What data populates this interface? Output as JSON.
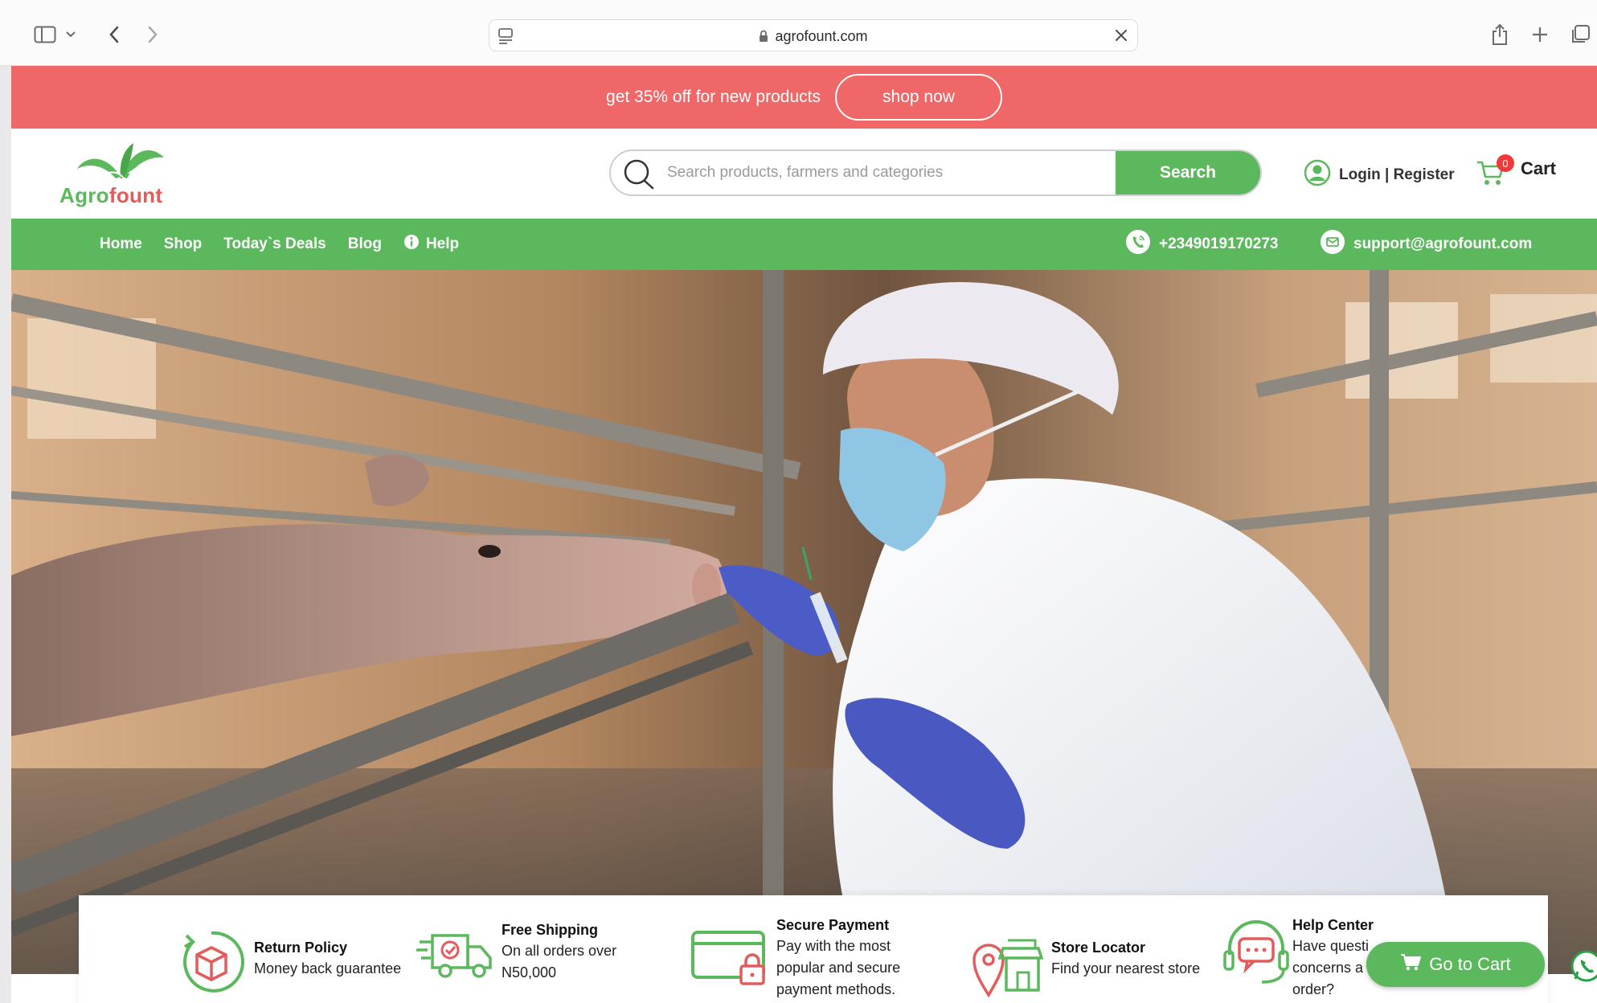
{
  "browser": {
    "url": "agrofount.com"
  },
  "promo": {
    "text": "get 35% off for new products",
    "button": "shop now"
  },
  "brand": {
    "name_part1": "Agro",
    "name_part2": "fount",
    "green": "#5cb85c",
    "red": "#e35b5b",
    "promo_bg": "#f06767"
  },
  "search": {
    "placeholder": "Search products, farmers and categories",
    "button": "Search"
  },
  "account": {
    "label": "Login | Register"
  },
  "cart": {
    "count": "0",
    "label": "Cart"
  },
  "nav": {
    "items": [
      {
        "label": "Home"
      },
      {
        "label": "Shop"
      },
      {
        "label": "Today`s Deals"
      },
      {
        "label": "Blog"
      },
      {
        "label": "Help",
        "icon": "info-icon"
      }
    ],
    "phone": "+2349019170273",
    "email": "support@agrofount.com"
  },
  "hero": {
    "slide_count": 5,
    "active_slide": 5
  },
  "features": [
    {
      "title": "Return Policy",
      "desc": [
        "Money back guarantee"
      ],
      "icon": "return-box-icon"
    },
    {
      "title": "Free Shipping",
      "desc": [
        "On all orders over",
        "N50,000"
      ],
      "icon": "delivery-truck-icon"
    },
    {
      "title": "Secure Payment",
      "desc": [
        "Pay with the most",
        "popular and secure",
        "payment methods."
      ],
      "icon": "secure-card-icon"
    },
    {
      "title": "Store Locator",
      "desc": [
        "Find your nearest store"
      ],
      "icon": "store-locator-icon"
    },
    {
      "title": "Help Center",
      "desc": [
        "Have questi",
        "concerns a",
        "order?"
      ],
      "icon": "chat-headset-icon"
    }
  ],
  "floating": {
    "go_to_cart": "Go to Cart"
  }
}
